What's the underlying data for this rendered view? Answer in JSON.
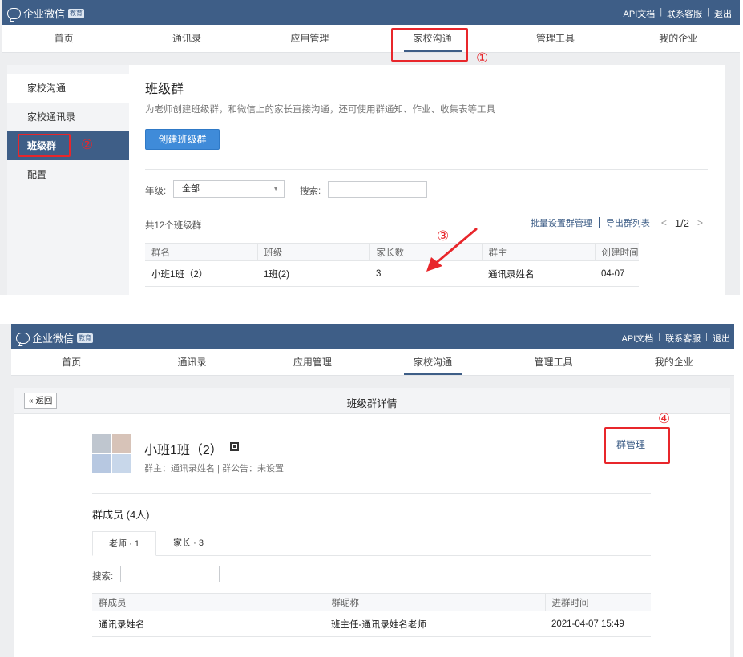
{
  "brand": {
    "name": "企业微信",
    "badge": "教育"
  },
  "toplinks": {
    "api": "API文档",
    "service": "联系客服",
    "logout": "退出",
    "sep": "|"
  },
  "nav": [
    "首页",
    "通讯录",
    "应用管理",
    "家校沟通",
    "管理工具",
    "我的企业"
  ],
  "annotations": {
    "n1": "①",
    "n2": "②",
    "n3": "③",
    "n4": "④",
    "color": "#e8262b"
  },
  "screen1": {
    "sidebar": [
      "家校沟通",
      "家校通讯录",
      "班级群",
      "配置"
    ],
    "title": "班级群",
    "desc": "为老师创建班级群，和微信上的家长直接沟通，还可使用群通知、作业、收集表等工具",
    "create_button": "创建班级群",
    "filter": {
      "grade_label": "年级:",
      "grade_value": "全部",
      "search_label": "搜索:"
    },
    "count": "共12个班级群",
    "actions": {
      "batch": "批量设置群管理",
      "export": "导出群列表",
      "page": "1/2"
    },
    "table": {
      "headers": [
        "群名",
        "班级",
        "家长数",
        "群主",
        "创建时间"
      ],
      "rows": [
        [
          "小班1班（2）",
          "1班(2)",
          "3",
          "通讯录姓名",
          "04-07"
        ]
      ]
    }
  },
  "screen2": {
    "back": "« 返回",
    "title": "班级群详情",
    "group_name": "小班1班（2）",
    "meta": "群主：通讯录姓名 |  群公告：未设置",
    "manage": "群管理",
    "members_title": "群成员 (4人)",
    "tabs": [
      "老师 · 1",
      "家长 · 3"
    ],
    "search_label": "搜索:",
    "table": {
      "headers": [
        "群成员",
        "群昵称",
        "进群时间"
      ],
      "rows": [
        [
          "通讯录姓名",
          "班主任-通讯录姓名老师",
          "2021-04-07 15:49"
        ]
      ]
    }
  },
  "colors": {
    "topbar": "#3e5e87",
    "primary_button": "#3f8bd9",
    "link": "#3e5e87"
  }
}
